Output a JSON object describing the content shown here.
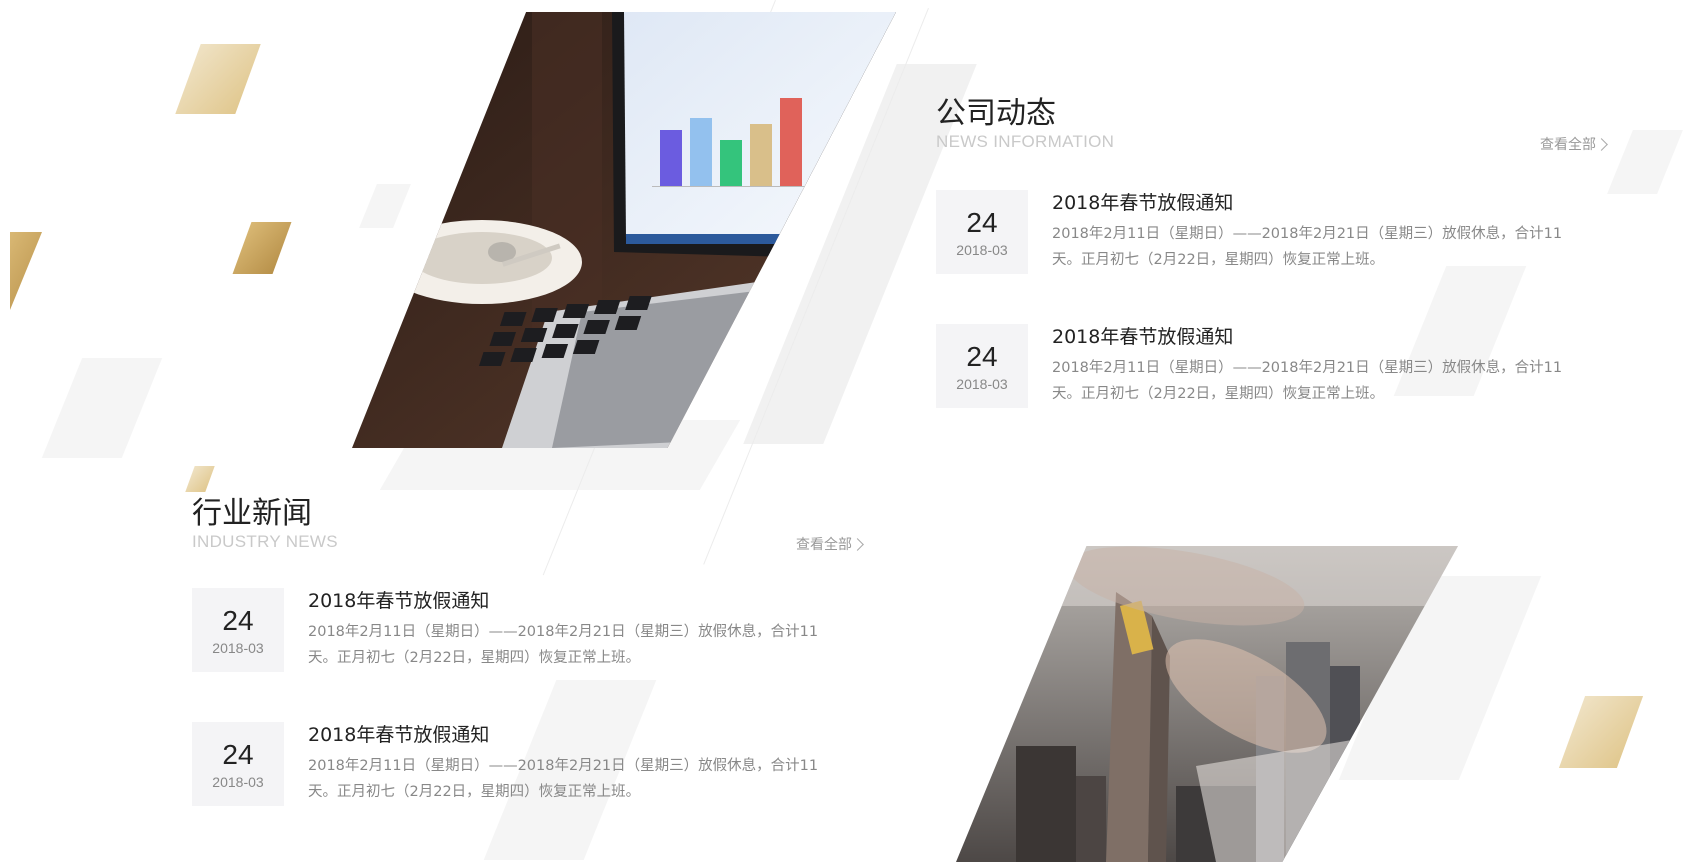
{
  "company_news": {
    "title": "公司动态",
    "subtitle": "NEWS INFORMATION",
    "view_all": "查看全部",
    "items": [
      {
        "day": "24",
        "month": "2018-03",
        "title": "2018年春节放假通知",
        "desc": "2018年2月11日（星期日）——2018年2月21日（星期三）放假休息，合计11天。正月初七（2月22日，星期四）恢复正常上班。"
      },
      {
        "day": "24",
        "month": "2018-03",
        "title": "2018年春节放假通知",
        "desc": "2018年2月11日（星期日）——2018年2月21日（星期三）放假休息，合计11天。正月初七（2月22日，星期四）恢复正常上班。"
      }
    ]
  },
  "industry_news": {
    "title": "行业新闻",
    "subtitle": "INDUSTRY NEWS",
    "view_all": "查看全部",
    "items": [
      {
        "day": "24",
        "month": "2018-03",
        "title": "2018年春节放假通知",
        "desc": "2018年2月11日（星期日）——2018年2月21日（星期三）放假休息，合计11天。正月初七（2月22日，星期四）恢复正常上班。"
      },
      {
        "day": "24",
        "month": "2018-03",
        "title": "2018年春节放假通知",
        "desc": "2018年2月11日（星期日）——2018年2月21日（星期三）放假休息，合计11天。正月初七（2月22日，星期四）恢复正常上班。"
      }
    ]
  },
  "colors": {
    "gold_light": "#e8d5a8",
    "gold_dark": "#c29e56",
    "shape_grey": "#f5f5f5"
  },
  "icons": {
    "view_all_arrow": "chevron-right-icon"
  }
}
